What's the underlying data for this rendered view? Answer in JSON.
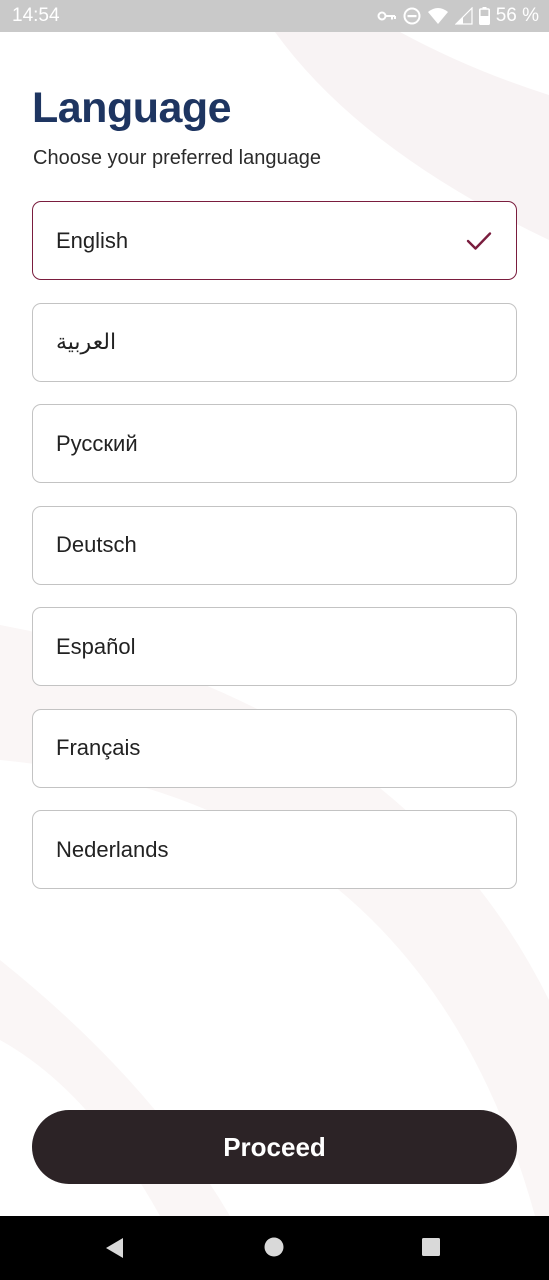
{
  "status_bar": {
    "time": "14:54",
    "battery": "56 %",
    "icons": [
      "vpn-key-icon",
      "do-not-disturb-icon",
      "wifi-icon",
      "signal-icon",
      "battery-icon"
    ]
  },
  "header": {
    "title": "Language",
    "subtitle": "Choose your preferred language"
  },
  "languages": [
    {
      "label": "English",
      "selected": true
    },
    {
      "label": "العربية",
      "selected": false
    },
    {
      "label": "Русский",
      "selected": false
    },
    {
      "label": "Deutsch",
      "selected": false
    },
    {
      "label": "Español",
      "selected": false
    },
    {
      "label": "Français",
      "selected": false
    },
    {
      "label": "Nederlands",
      "selected": false
    }
  ],
  "actions": {
    "proceed_label": "Proceed"
  },
  "nav": {
    "icons": [
      "back-icon",
      "home-icon",
      "recents-icon"
    ]
  },
  "colors": {
    "title": "#1e3561",
    "selected_border": "#7a1d3e",
    "check": "#7a1d3e",
    "button_bg": "#2c2326",
    "option_border": "#c3c3c3"
  }
}
